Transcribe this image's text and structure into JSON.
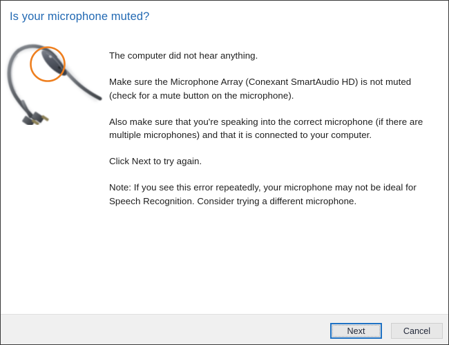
{
  "window": {
    "title": "Is your microphone muted?",
    "title_color": "#2269b3",
    "background": "#ffffff",
    "border_color": "#3a3a3a"
  },
  "illustration": {
    "name": "headset-microphone-cable-with-inline-control",
    "highlight_label": "inline mute control highlighted",
    "highlight_color": "#ee7f1f",
    "cable_color": "#6f7379",
    "module_color": "#565b66"
  },
  "body": {
    "paragraphs": [
      "The computer did not hear anything.",
      "Make sure the Microphone Array (Conexant SmartAudio HD) is not muted (check for a mute button on the microphone).",
      "Also make sure that you're speaking into the correct microphone (if there are multiple microphones) and that it is connected to your computer.",
      "Click Next to try again.",
      "Note: If you see this error repeatedly, your microphone may not be ideal for Speech Recognition. Consider trying a different microphone."
    ]
  },
  "footer": {
    "background": "#f0f0f0",
    "buttons": {
      "next_label": "Next",
      "cancel_label": "Cancel",
      "default_button": "Next",
      "focus_color": "#1f72c4"
    }
  }
}
